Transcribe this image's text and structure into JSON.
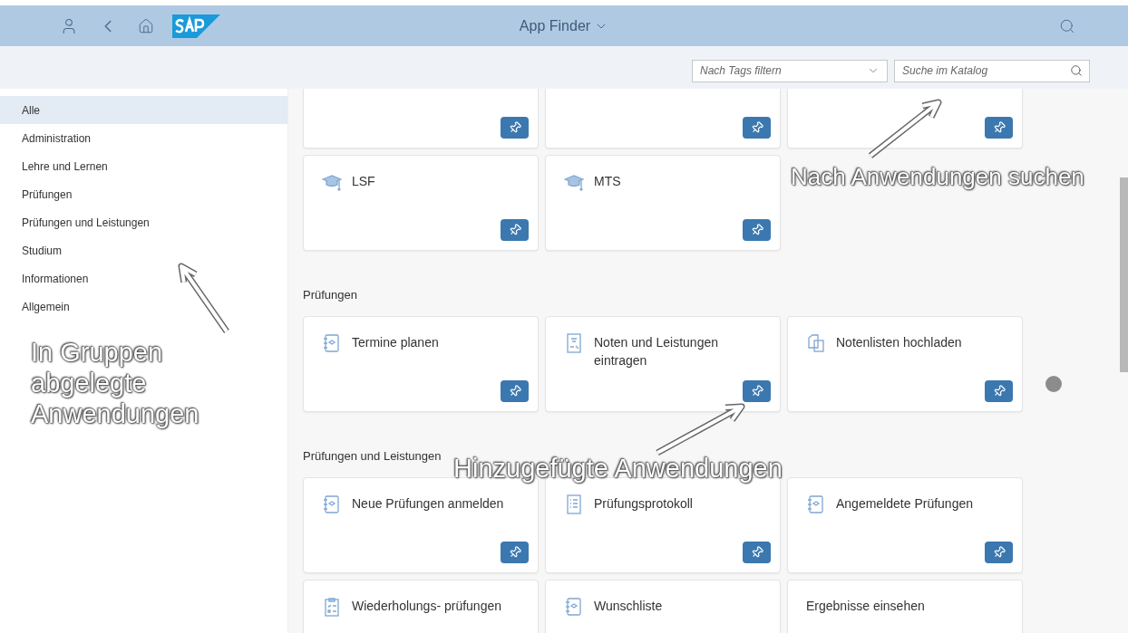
{
  "shell": {
    "title": "App Finder",
    "tag_filter": {
      "placeholder": "Nach Tags filtern"
    },
    "search": {
      "placeholder": "Suche im Katalog"
    }
  },
  "sidebar": {
    "items": [
      {
        "label": "Alle",
        "selected": true
      },
      {
        "label": "Administration",
        "selected": false
      },
      {
        "label": "Lehre und Lernen",
        "selected": false
      },
      {
        "label": "Prüfungen",
        "selected": false
      },
      {
        "label": "Prüfungen und Leistungen",
        "selected": false
      },
      {
        "label": "Studium",
        "selected": false
      },
      {
        "label": "Informationen",
        "selected": false
      },
      {
        "label": "Allgemein",
        "selected": false
      }
    ]
  },
  "sections": [
    {
      "tiles": [
        {
          "kind": "cut"
        },
        {
          "kind": "cut"
        },
        {
          "kind": "cut"
        },
        {
          "title": "LSF",
          "kind": "cap"
        },
        {
          "title": "MTS",
          "kind": "cap"
        }
      ]
    },
    {
      "heading": "Prüfungen",
      "tiles": [
        {
          "title": "Termine planen",
          "kind": "notebook"
        },
        {
          "title": "Noten und Leistungen eintragen",
          "kind": "form"
        },
        {
          "title": "Notenlisten hochladen",
          "kind": "docs"
        }
      ]
    },
    {
      "heading": "Prüfungen und Leistungen",
      "tiles": [
        {
          "title": "Neue Prüfungen anmelden",
          "kind": "notebook"
        },
        {
          "title": "Prüfungsprotokoll",
          "kind": "list"
        },
        {
          "title": "Angemeldete Prüfungen",
          "kind": "notebook"
        },
        {
          "title": "Wiederholungs- prüfungen",
          "kind": "checklist"
        },
        {
          "title": "Wunschliste",
          "kind": "notebook"
        },
        {
          "title": "Ergebnisse einsehen",
          "kind": "plain"
        }
      ]
    }
  ],
  "annotations": [
    {
      "text": "Nach Anwendungen suchen"
    },
    {
      "text": "In Gruppen abgelegte Anwendungen"
    },
    {
      "text": "Hinzugefügte Anwendungen"
    }
  ]
}
